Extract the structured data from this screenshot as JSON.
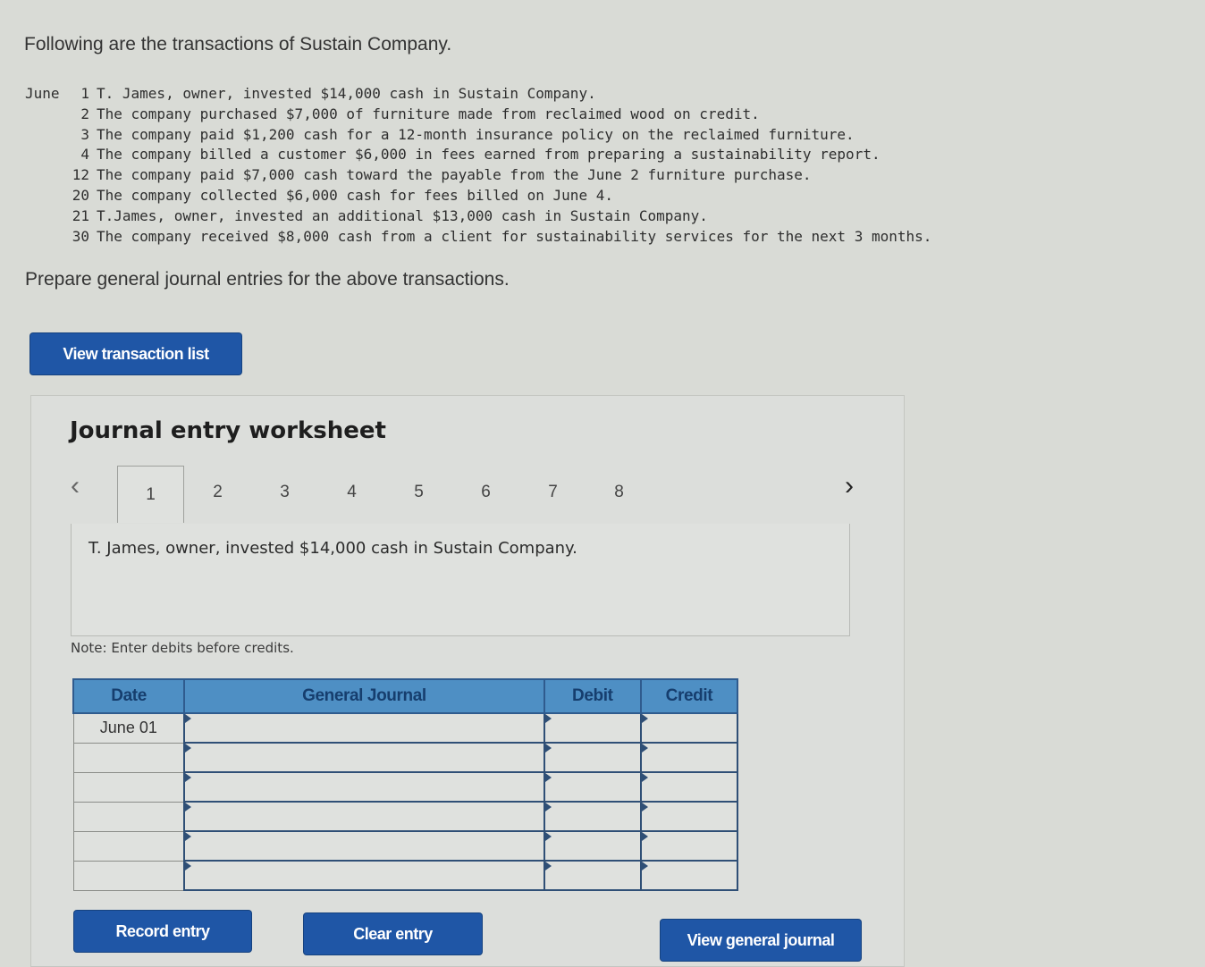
{
  "intro": "Following are the transactions of Sustain Company.",
  "transactions": {
    "month": "June",
    "items": [
      {
        "day": "1",
        "text": "T. James, owner, invested $14,000 cash in Sustain Company."
      },
      {
        "day": "2",
        "text": "The company purchased $7,000 of furniture made from reclaimed wood on credit."
      },
      {
        "day": "3",
        "text": "The company paid $1,200 cash for a 12-month insurance policy on the reclaimed furniture."
      },
      {
        "day": "4",
        "text": "The company billed a customer $6,000 in fees earned from preparing a sustainability report."
      },
      {
        "day": "12",
        "text": "The company paid $7,000 cash toward the payable from the June 2 furniture purchase."
      },
      {
        "day": "20",
        "text": "The company collected $6,000 cash for fees billed on June 4."
      },
      {
        "day": "21",
        "text": "T.James, owner, invested an additional $13,000 cash in Sustain Company."
      },
      {
        "day": "30",
        "text": "The company received $8,000 cash from a client for sustainability services for the next 3 months."
      }
    ]
  },
  "instruction": "Prepare general journal entries for the above transactions.",
  "buttons": {
    "view_transaction_list": "View transaction list",
    "record_entry": "Record entry",
    "clear_entry": "Clear entry",
    "view_general_journal": "View general journal"
  },
  "worksheet": {
    "title": "Journal entry worksheet",
    "prev_icon": "‹",
    "next_icon": "›",
    "tabs": [
      "1",
      "2",
      "3",
      "4",
      "5",
      "6",
      "7",
      "8"
    ],
    "active_tab": "1",
    "description": "T. James, owner, invested $14,000 cash in Sustain Company.",
    "note": "Note: Enter debits before credits.",
    "table": {
      "headers": [
        "Date",
        "General Journal",
        "Debit",
        "Credit"
      ],
      "rows": [
        {
          "date": "June 01",
          "account": "",
          "debit": "",
          "credit": ""
        },
        {
          "date": "",
          "account": "",
          "debit": "",
          "credit": ""
        },
        {
          "date": "",
          "account": "",
          "debit": "",
          "credit": ""
        },
        {
          "date": "",
          "account": "",
          "debit": "",
          "credit": ""
        },
        {
          "date": "",
          "account": "",
          "debit": "",
          "credit": ""
        },
        {
          "date": "",
          "account": "",
          "debit": "",
          "credit": ""
        }
      ]
    }
  },
  "colors": {
    "button_blue": "#1f56a6",
    "header_blue": "#4e8fc4"
  }
}
